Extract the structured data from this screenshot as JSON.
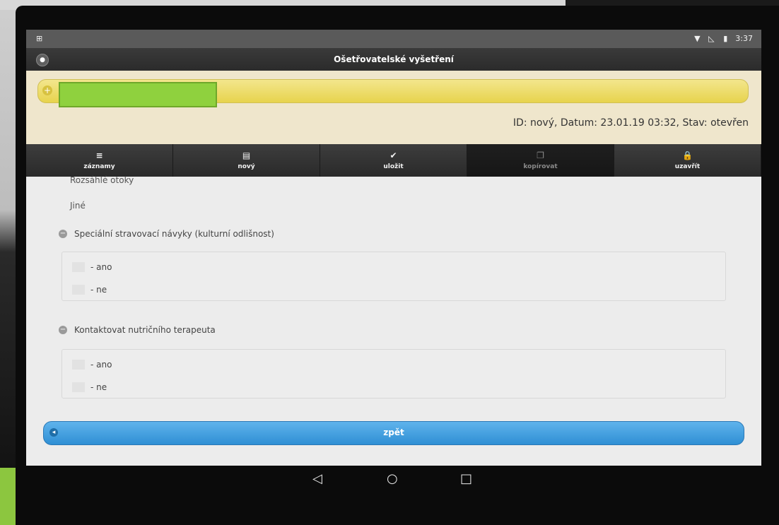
{
  "statusbar": {
    "time": "3:37"
  },
  "titlebar": {
    "title": "Ošetřovatelské vyšetření"
  },
  "header": {
    "record_info": "ID: nový, Datum: 23.01.19 03:32, Stav: otevřen"
  },
  "toolbar": [
    {
      "label": "záznamy",
      "icon": "list-icon"
    },
    {
      "label": "nový",
      "icon": "new-document-icon"
    },
    {
      "label": "uložit",
      "icon": "check-icon"
    },
    {
      "label": "kopírovat",
      "icon": "copy-icon"
    },
    {
      "label": "uzavřít",
      "icon": "lock-icon"
    }
  ],
  "content": {
    "partial_item": "Rozsáhlé otoky",
    "other_item": "Jiné",
    "sections": [
      {
        "title": "Speciální stravovací návyky (kulturní odlišnost)",
        "options": [
          "- ano",
          "- ne"
        ]
      },
      {
        "title": "Kontaktovat nutričního terapeuta",
        "options": [
          "- ano",
          "- ne"
        ]
      }
    ]
  },
  "footer": {
    "back_label": "zpět"
  }
}
